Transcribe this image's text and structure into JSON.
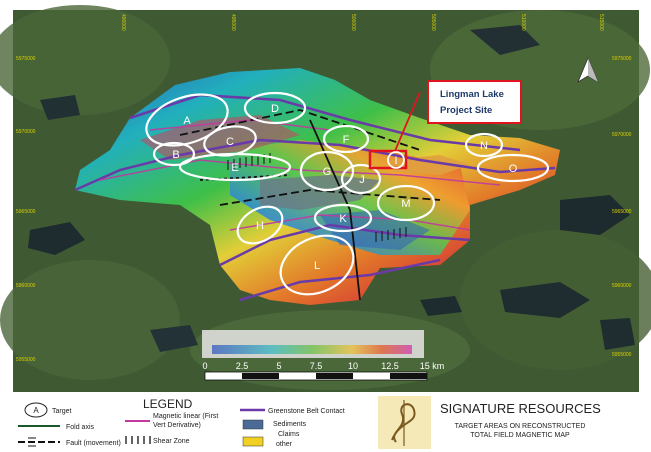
{
  "map": {
    "title_box": {
      "line1": "Lingman Lake",
      "line2": "Project Site"
    },
    "top_ticks": [
      "490000",
      "495000",
      "500000",
      "505000",
      "510000",
      "515000"
    ],
    "left_ticks": [
      "5975000",
      "5970000",
      "5965000",
      "5960000",
      "5955000"
    ],
    "right_ticks": [
      "5975000",
      "5970000",
      "5965000",
      "5960000",
      "5955000"
    ],
    "targets": [
      "A",
      "B",
      "C",
      "D",
      "E",
      "F",
      "G",
      "H",
      "I",
      "J",
      "K",
      "L",
      "M",
      "N",
      "O"
    ],
    "scale": {
      "labels": [
        "0",
        "2.5",
        "5",
        "7.5",
        "10",
        "12.5",
        "15 km"
      ]
    }
  },
  "legend": {
    "heading": "LEGEND",
    "target": "Target",
    "fold_axis": "Fold axis",
    "fault": "Fault (movement)",
    "mag_linear_1": "Magnetic linear (First",
    "mag_linear_2": "Vert Derivative)",
    "shear_zone": "Shear Zone",
    "greenstone": "Greenstone Belt Contact",
    "sediments": "Sediments",
    "claims": "Claims",
    "other": "other"
  },
  "company": {
    "name": "SIGNATURE RESOURCES",
    "sub1": "TARGET AREAS ON RECONSTRUCTED",
    "sub2": "TOTAL FIELD MAGNETIC MAP"
  },
  "colors": {
    "callout": "#e0141e",
    "greenstone": "#6a3aa8",
    "magnetic_linear": "#c03aa0",
    "sediments": "#4a6a98",
    "claims": "#f0d020"
  }
}
